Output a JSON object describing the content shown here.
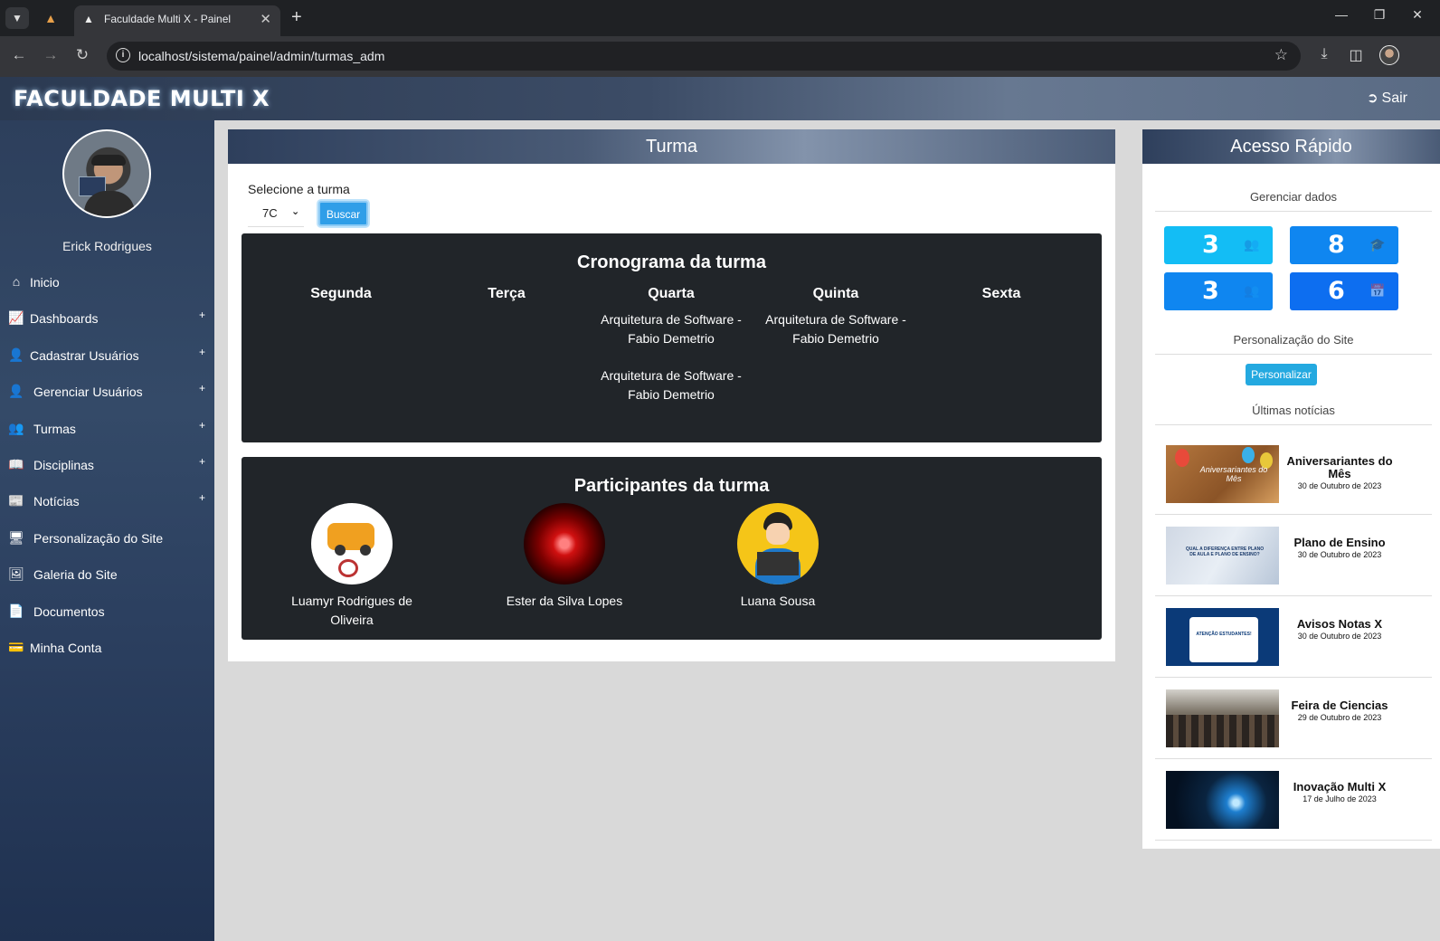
{
  "browser": {
    "tab_title": "Faculdade Multi X - Painel",
    "url": "localhost/sistema/painel/admin/turmas_adm"
  },
  "header": {
    "brand": "FACULDADE MULTI X",
    "logout_label": "Sair"
  },
  "sidebar": {
    "user_name": "Erick Rodrigues",
    "items": [
      {
        "label": "Inicio",
        "icon": "home-icon",
        "expandable": false
      },
      {
        "label": "Dashboards",
        "icon": "chart-line-icon",
        "expandable": true
      },
      {
        "label": "Cadastrar Usuários",
        "icon": "user-plus-icon",
        "expandable": true
      },
      {
        "label": "Gerenciar Usuários",
        "icon": "user-gear-icon",
        "expandable": true
      },
      {
        "label": "Turmas",
        "icon": "users-icon",
        "expandable": true
      },
      {
        "label": "Disciplinas",
        "icon": "book-open-icon",
        "expandable": true
      },
      {
        "label": "Notícias",
        "icon": "newspaper-icon",
        "expandable": true
      },
      {
        "label": "Personalização do Site",
        "icon": "display-icon",
        "expandable": false
      },
      {
        "label": "Galeria do Site",
        "icon": "image-icon",
        "expandable": false
      },
      {
        "label": "Documentos",
        "icon": "file-icon",
        "expandable": false
      },
      {
        "label": "Minha Conta",
        "icon": "id-card-icon",
        "expandable": false
      }
    ]
  },
  "turma": {
    "title": "Turma",
    "select_label": "Selecione a turma",
    "selected_turma": "7C",
    "search_button": "Buscar",
    "schedule": {
      "title": "Cronograma da turma",
      "days": [
        {
          "name": "Segunda",
          "classes": []
        },
        {
          "name": "Terça",
          "classes": []
        },
        {
          "name": "Quarta",
          "classes": [
            "Arquitetura de Software - Fabio Demetrio",
            "Arquitetura de Software - Fabio Demetrio"
          ]
        },
        {
          "name": "Quinta",
          "classes": [
            "Arquitetura de Software - Fabio Demetrio"
          ]
        },
        {
          "name": "Sexta",
          "classes": []
        }
      ]
    },
    "participants": {
      "title": "Participantes da turma",
      "people": [
        {
          "name": "Luamyr Rodrigues de Oliveira"
        },
        {
          "name": "Ester da Silva Lopes"
        },
        {
          "name": "Luana Sousa"
        }
      ]
    }
  },
  "quick_access": {
    "title": "Acesso Rápido",
    "manage_label": "Gerenciar dados",
    "stats": [
      {
        "value": "3",
        "icon": "users-icon",
        "color": "#13bdf5"
      },
      {
        "value": "8",
        "icon": "graduate-icon",
        "color": "#0f86f0"
      },
      {
        "value": "3",
        "icon": "users-icon",
        "color": "#0f86f0"
      },
      {
        "value": "6",
        "icon": "calendar-icon",
        "color": "#0d6ef0"
      }
    ],
    "customize_label": "Personalização do Site",
    "customize_button": "Personalizar",
    "news_label": "Últimas notícias",
    "news": [
      {
        "title": "Aniversariantes do Mês",
        "date": "30 de Outubro de 2023",
        "thumb_text": "Aniversariantes do Mês"
      },
      {
        "title": "Plano de Ensino",
        "date": "30 de Outubro de 2023",
        "thumb_text": "QUAL A DIFERENÇA ENTRE PLANO DE AULA E PLANO DE ENSINO?"
      },
      {
        "title": "Avisos Notas X",
        "date": "30 de Outubro de 2023",
        "thumb_text": "ATENÇÃO ESTUDANTES!"
      },
      {
        "title": "Feira de Ciencias",
        "date": "29 de Outubro de 2023",
        "thumb_text": ""
      },
      {
        "title": "Inovação Multi X",
        "date": "17 de Julho de 2023",
        "thumb_text": ""
      }
    ]
  }
}
